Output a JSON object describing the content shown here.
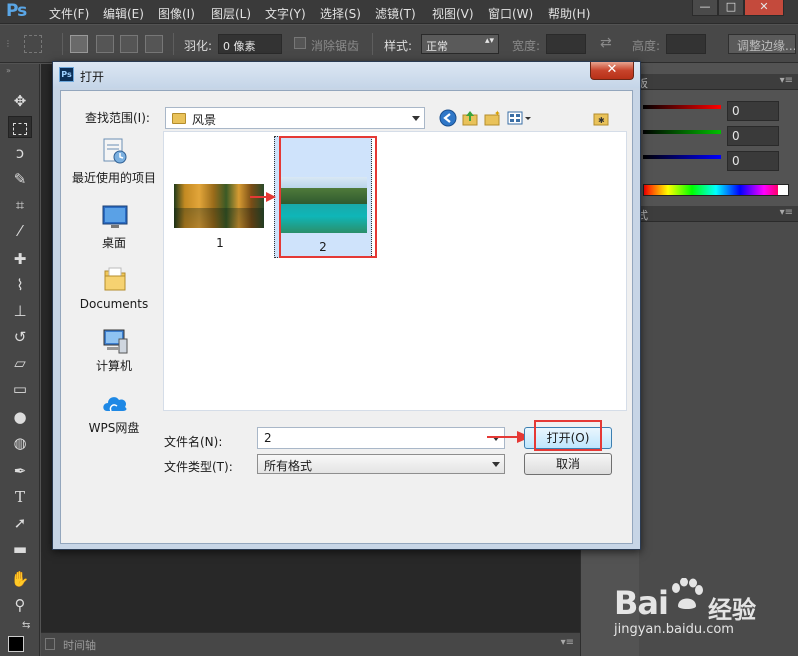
{
  "photoshop": {
    "logo": "Ps",
    "menu": [
      "文件(F)",
      "编辑(E)",
      "图像(I)",
      "图层(L)",
      "文字(Y)",
      "选择(S)",
      "滤镜(T)",
      "视图(V)",
      "窗口(W)",
      "帮助(H)"
    ],
    "options": {
      "feather_label": "羽化:",
      "feather_value": "0 像素",
      "antialias_label": "消除锯齿",
      "style_label": "样式:",
      "style_value": "正常",
      "width_label": "宽度:",
      "height_label": "高度:",
      "refine_edge_button": "调整边缘..."
    },
    "timeline_label": "时间轴",
    "color_panel_values": [
      "0",
      "0",
      "0"
    ],
    "panel_tab": "板",
    "panel_tab2": "式"
  },
  "dialog": {
    "title": "打开",
    "look_in_label": "查找范围(I):",
    "look_in_value": "风景",
    "places": [
      {
        "label": "最近使用的项目",
        "icon": "recent-items-icon"
      },
      {
        "label": "桌面",
        "icon": "desktop-icon"
      },
      {
        "label": "Documents",
        "icon": "documents-folder-icon"
      },
      {
        "label": "计算机",
        "icon": "computer-icon"
      },
      {
        "label": "WPS网盘",
        "icon": "wps-cloud-icon"
      }
    ],
    "files": [
      {
        "name": "1",
        "selected": false
      },
      {
        "name": "2",
        "selected": true
      }
    ],
    "file_name_label": "文件名(N):",
    "file_name_value": "2",
    "file_type_label": "文件类型(T):",
    "file_type_value": "所有格式",
    "open_button": "打开(O)",
    "cancel_button": "取消"
  },
  "watermark": {
    "logo_left": "Bai",
    "logo_right": "经验",
    "url": "jingyan.baidu.com"
  },
  "colors": {
    "annotation_red": "#e53935",
    "selection_blue": "#cfe3fb"
  }
}
